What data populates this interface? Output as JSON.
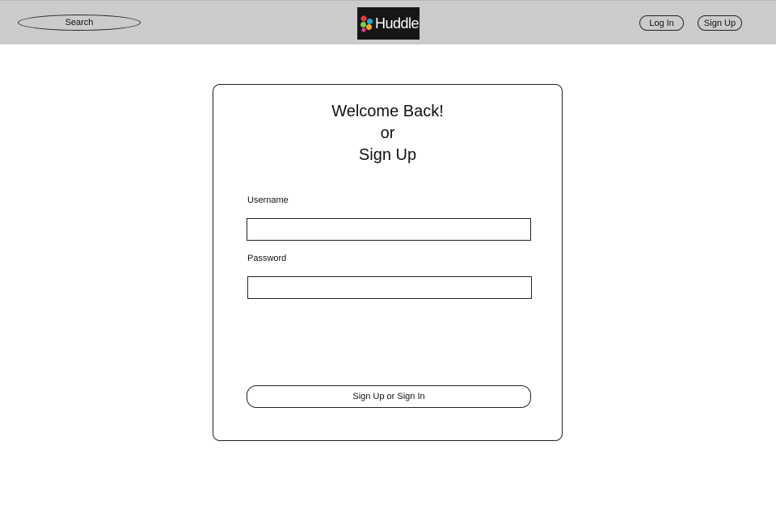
{
  "header": {
    "search_label": "Search",
    "logo_text": "Huddle",
    "logo_dot_colors": [
      "#e53b3b",
      "#1aa8d6",
      "#7ac943",
      "#f5a623",
      "#e83e8c"
    ],
    "login_label": "Log In",
    "signup_label": "Sign Up"
  },
  "form": {
    "heading_line1": "Welcome Back!",
    "heading_line2": "or",
    "heading_line3": "Sign Up",
    "username_label": "Username",
    "username_value": "",
    "password_label": "Password",
    "password_value": "",
    "submit_label": "Sign Up or Sign In"
  },
  "colors": {
    "header_bg": "#cbcbcb",
    "logo_bg": "#161616"
  }
}
